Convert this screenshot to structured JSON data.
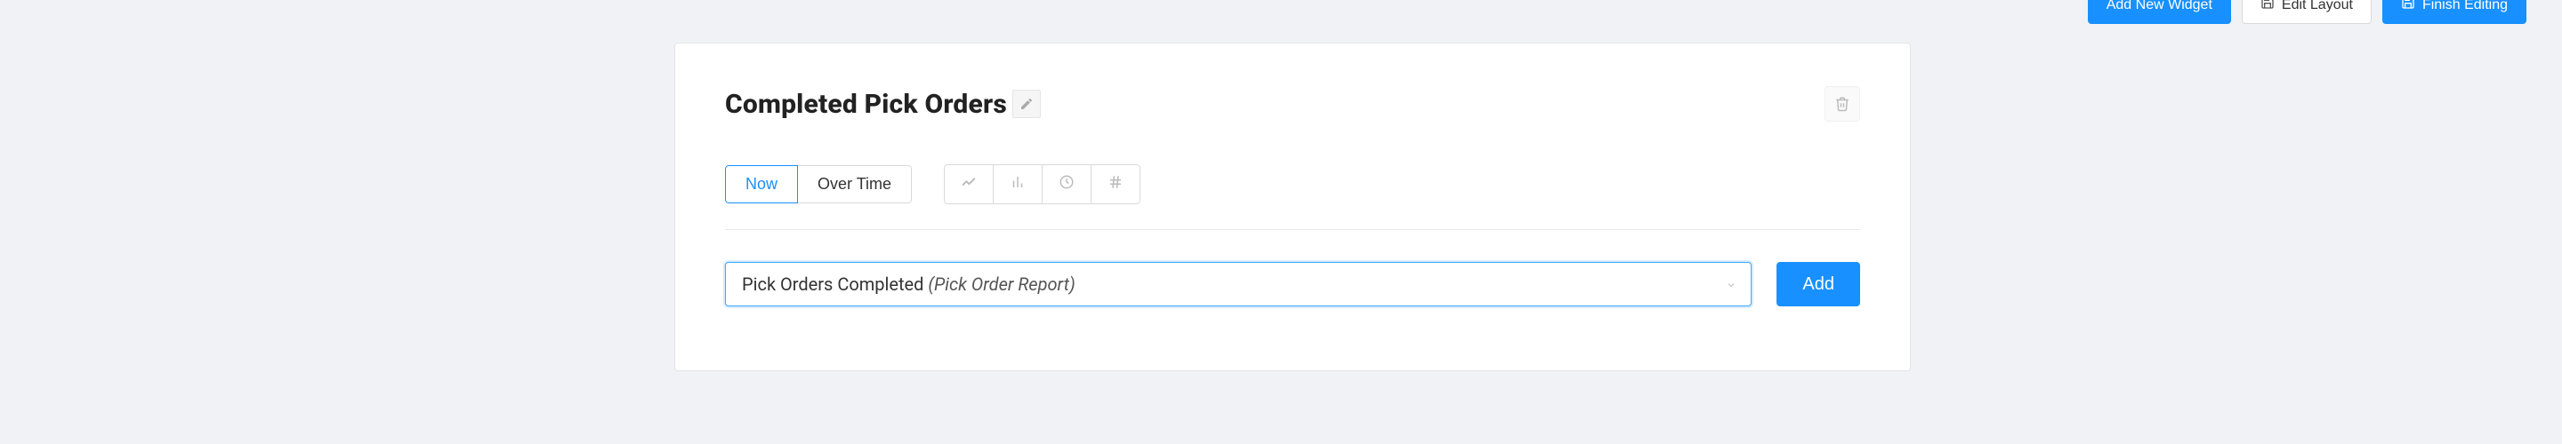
{
  "top": {
    "add_widget": "Add New Widget",
    "edit_layout": "Edit Layout",
    "finish_editing": "Finish Editing"
  },
  "card": {
    "title": "Completed Pick Orders",
    "tabs": {
      "now": "Now",
      "over_time": "Over Time"
    },
    "select": {
      "main": "Pick Orders Completed ",
      "sub": "(Pick Order Report)"
    },
    "add_label": "Add"
  }
}
